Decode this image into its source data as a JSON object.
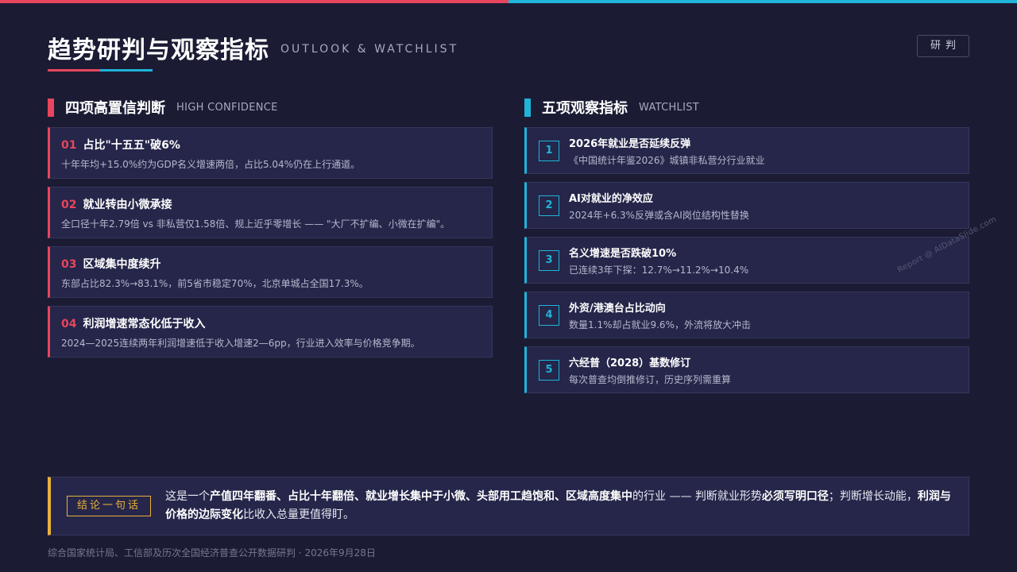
{
  "colors": {
    "accent_red": "#e8455e",
    "accent_cyan": "#1fb4d8",
    "accent_gold": "#e9b03a",
    "background": "#1b1c34"
  },
  "header": {
    "title": "趋势研判与观察指标",
    "subtitle": "OUTLOOK & WATCHLIST",
    "tag": "研判"
  },
  "left_section": {
    "title": "四项高置信判断",
    "title_en": "HIGH CONFIDENCE",
    "items": [
      {
        "num": "01",
        "title": "占比\"十五五\"破6%",
        "desc": "十年年均+15.0%约为GDP名义增速两倍，占比5.04%仍在上行通道。"
      },
      {
        "num": "02",
        "title": "就业转由小微承接",
        "desc": "全口径十年2.79倍 vs 非私营仅1.58倍、规上近乎零增长 —— \"大厂不扩编、小微在扩编\"。"
      },
      {
        "num": "03",
        "title": "区域集中度续升",
        "desc": "东部占比82.3%→83.1%，前5省市稳定70%，北京单城占全国17.3%。"
      },
      {
        "num": "04",
        "title": "利润增速常态化低于收入",
        "desc": "2024—2025连续两年利润增速低于收入增速2—6pp，行业进入效率与价格竞争期。"
      }
    ]
  },
  "right_section": {
    "title": "五项观察指标",
    "title_en": "WATCHLIST",
    "items": [
      {
        "num": "1",
        "title": "2026年就业是否延续反弹",
        "desc": "《中国统计年鉴2026》城镇非私营分行业就业"
      },
      {
        "num": "2",
        "title": "AI对就业的净效应",
        "desc": "2024年+6.3%反弹或含AI岗位结构性替换"
      },
      {
        "num": "3",
        "title": "名义增速是否跌破10%",
        "desc": "已连续3年下探：12.7%→11.2%→10.4%"
      },
      {
        "num": "4",
        "title": "外资/港澳台占比动向",
        "desc": "数量1.1%却占就业9.6%，外流将放大冲击"
      },
      {
        "num": "5",
        "title": "六经普（2028）基数修订",
        "desc": "每次普查均倒推修订，历史序列需重算"
      }
    ]
  },
  "watermark": "Report @ AIDataSlide.com",
  "conclusion": {
    "label": "结论一句话",
    "parts": [
      {
        "text": "这是一个",
        "bold": false
      },
      {
        "text": "产值四年翻番、占比十年翻倍、就业增长集中于小微、头部用工趋饱和、区域高度集中",
        "bold": true
      },
      {
        "text": "的行业 —— 判断就业形势",
        "bold": false
      },
      {
        "text": "必须写明口径",
        "bold": true
      },
      {
        "text": "；判断增长动能，",
        "bold": false
      },
      {
        "text": "利润与价格的边际变化",
        "bold": true
      },
      {
        "text": "比收入总量更值得盯。",
        "bold": false
      }
    ]
  },
  "footer": "综合国家统计局、工信部及历次全国经济普查公开数据研判 · 2026年9月28日"
}
